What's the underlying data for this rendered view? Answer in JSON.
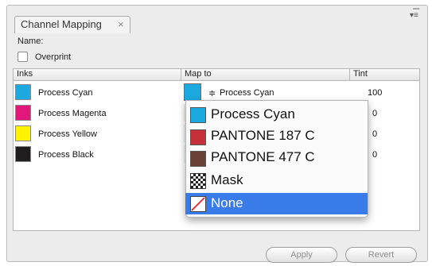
{
  "panel": {
    "tab_title": "Channel Mapping",
    "tab_close": "×",
    "collapse_glyph": "–",
    "menu_glyph": "▾≡",
    "name_label": "Name:",
    "overprint_label": "Overprint",
    "overprint_checked": false
  },
  "columns": {
    "inks": "Inks",
    "map_to": "Map to",
    "tint": "Tint"
  },
  "inks": [
    {
      "name": "Process Cyan",
      "color": "#1ba9df",
      "map_to": "Process Cyan",
      "tint": "100"
    },
    {
      "name": "Process Magenta",
      "color": "#e1177a",
      "tint_partial": "0"
    },
    {
      "name": "Process Yellow",
      "color": "#fff200",
      "tint_partial": "0"
    },
    {
      "name": "Process Black",
      "color": "#1f1d1e",
      "tint_partial": "0"
    }
  ],
  "map_indicator": "≑",
  "dropdown": {
    "items": [
      {
        "label": "Process Cyan",
        "icon": "cyan-swatch-icon",
        "color": "#1ba9df"
      },
      {
        "label": "PANTONE 187 C",
        "icon": "pantone-187-swatch-icon",
        "color": "#c5303a"
      },
      {
        "label": "PANTONE 477 C",
        "icon": "pantone-477-swatch-icon",
        "color": "#6a4235"
      },
      {
        "label": "Mask",
        "icon": "checkerboard-icon"
      },
      {
        "label": "None",
        "icon": "none-slash-icon",
        "selected": true,
        "highlight": "#3a7bea"
      }
    ]
  },
  "buttons": {
    "apply": "Apply",
    "revert": "Revert"
  }
}
